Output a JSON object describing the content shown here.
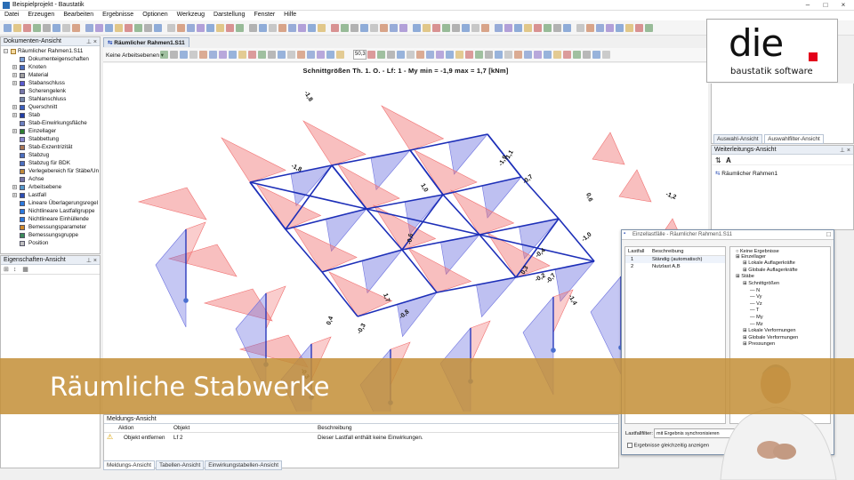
{
  "window": {
    "title": "Beispielprojekt - Baustatik",
    "controls": [
      "–",
      "□",
      "×"
    ]
  },
  "menu": [
    "Datei",
    "Erzeugen",
    "Bearbeiten",
    "Ergebnisse",
    "Optionen",
    "Werkzeug",
    "Darstellung",
    "Fenster",
    "Hilfe"
  ],
  "doc_panel": {
    "title": "Dokumenten-Ansicht",
    "root": "Räumlicher Rahmen1.S11",
    "items": [
      "Dokumenteigenschaften",
      "Knoten",
      "Material",
      "Stabanschluss",
      "Scherengelenk",
      "Stahlanschluss",
      "Querschnitt",
      "Stab",
      "Stab-Einwirkungsfläche",
      "Einzellager",
      "Stabbettung",
      "Stab-Exzentrizität",
      "Stabzug",
      "Stabzug für BDK",
      "Verlegebereich für Stäbe/Un",
      "Achse",
      "Arbeitsebene",
      "Lastfall",
      "Lineare Überlagerungsregel",
      "Nichtlineare Lastfallgruppe",
      "Nichtlineare Einhüllende",
      "Bemessungsparameter",
      "Bemessungsgruppe",
      "Position"
    ]
  },
  "props_panel": {
    "title": "Eigenschaften-Ansicht"
  },
  "document_tab": "Räumlicher Rahmen1.S11",
  "work_plane_select": "Keine Arbeitsebenen",
  "zoom_value": "50,3",
  "chart_title": "Schnittgrößen Th. 1. O. - Lf: 1 - My min = -1,9 max = 1,7 [kNm]",
  "member_labels": [
    "-1,8",
    "-1,8",
    "-1,1",
    "1,0",
    "-1,9",
    "-0,7",
    "0,6",
    "-1,2",
    "-0,6",
    "1,7",
    "-0,8",
    "0,4",
    "-0,3",
    "-0,2",
    "-0,7",
    "-1,0",
    "-1,4",
    "0,3",
    "-0,4",
    "-0,3"
  ],
  "right_top": {
    "tabs": [
      "Auswahl-Ansicht",
      "Auswahlfilter-Ansicht"
    ]
  },
  "forward_panel": {
    "title": "Weiterleitungs-Ansicht",
    "item": "Räumlicher Rahmen1"
  },
  "logo": {
    "word": "die",
    "sub": "baustatik software",
    "dot_color": "#e3001b"
  },
  "dialog": {
    "title": "Einzellastfälle - Räumlicher Rahmen1.S11",
    "col_lastfall": "Lastfall",
    "col_beschreibung": "Beschreibung",
    "rows": [
      {
        "nr": "1",
        "desc": "Ständig (automatisch)"
      },
      {
        "nr": "2",
        "desc": "Nutzlast A,B"
      }
    ],
    "results_tree": [
      "Keine Ergebnisse",
      "Einzellager",
      "Lokale Auflagerkräfte",
      "Globale Auflagerkräfte",
      "Stäbe",
      "Schnittgrößen",
      "N",
      "Vy",
      "Vz",
      "T",
      "My",
      "Mz",
      "Lokale Verformungen",
      "Globale Verformungen",
      "Pressungen"
    ],
    "filter_label": "Lastfallfilter:",
    "filter_value": "mit Ergebnis synchronisieren",
    "checkbox_label": "Ergebnisse gleichzeitig anzeigen"
  },
  "messages": {
    "title": "Meldungs-Ansicht",
    "col_action": "Aktion",
    "col_object": "Objekt",
    "col_desc": "Beschreibung",
    "row": {
      "action": "Objekt entfernen",
      "object": "Lf 2",
      "desc": "Dieser Lastfall enthält keine Einwirkungen."
    }
  },
  "bottom_tabs": [
    "Meldungs-Ansicht",
    "Tabellen-Ansicht",
    "Einwirkungstabellen-Ansicht"
  ],
  "banner_text": "Räumliche Stabwerke",
  "colors": {
    "positive": "#f07070",
    "negative": "#6f74e0",
    "member": "#1d2fb8",
    "banner": "#c48f38"
  }
}
